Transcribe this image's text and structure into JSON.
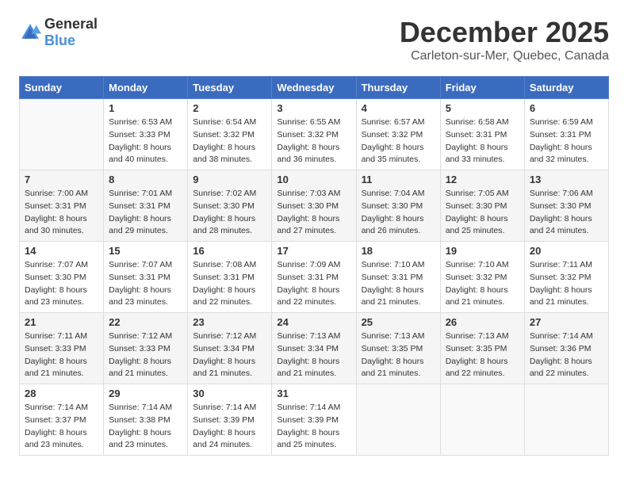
{
  "logo": {
    "text_general": "General",
    "text_blue": "Blue"
  },
  "title": {
    "month": "December 2025",
    "location": "Carleton-sur-Mer, Quebec, Canada"
  },
  "weekdays": [
    "Sunday",
    "Monday",
    "Tuesday",
    "Wednesday",
    "Thursday",
    "Friday",
    "Saturday"
  ],
  "weeks": [
    [
      {
        "day": "",
        "sunrise": "",
        "sunset": "",
        "daylight": ""
      },
      {
        "day": "1",
        "sunrise": "Sunrise: 6:53 AM",
        "sunset": "Sunset: 3:33 PM",
        "daylight": "Daylight: 8 hours and 40 minutes."
      },
      {
        "day": "2",
        "sunrise": "Sunrise: 6:54 AM",
        "sunset": "Sunset: 3:32 PM",
        "daylight": "Daylight: 8 hours and 38 minutes."
      },
      {
        "day": "3",
        "sunrise": "Sunrise: 6:55 AM",
        "sunset": "Sunset: 3:32 PM",
        "daylight": "Daylight: 8 hours and 36 minutes."
      },
      {
        "day": "4",
        "sunrise": "Sunrise: 6:57 AM",
        "sunset": "Sunset: 3:32 PM",
        "daylight": "Daylight: 8 hours and 35 minutes."
      },
      {
        "day": "5",
        "sunrise": "Sunrise: 6:58 AM",
        "sunset": "Sunset: 3:31 PM",
        "daylight": "Daylight: 8 hours and 33 minutes."
      },
      {
        "day": "6",
        "sunrise": "Sunrise: 6:59 AM",
        "sunset": "Sunset: 3:31 PM",
        "daylight": "Daylight: 8 hours and 32 minutes."
      }
    ],
    [
      {
        "day": "7",
        "sunrise": "Sunrise: 7:00 AM",
        "sunset": "Sunset: 3:31 PM",
        "daylight": "Daylight: 8 hours and 30 minutes."
      },
      {
        "day": "8",
        "sunrise": "Sunrise: 7:01 AM",
        "sunset": "Sunset: 3:31 PM",
        "daylight": "Daylight: 8 hours and 29 minutes."
      },
      {
        "day": "9",
        "sunrise": "Sunrise: 7:02 AM",
        "sunset": "Sunset: 3:30 PM",
        "daylight": "Daylight: 8 hours and 28 minutes."
      },
      {
        "day": "10",
        "sunrise": "Sunrise: 7:03 AM",
        "sunset": "Sunset: 3:30 PM",
        "daylight": "Daylight: 8 hours and 27 minutes."
      },
      {
        "day": "11",
        "sunrise": "Sunrise: 7:04 AM",
        "sunset": "Sunset: 3:30 PM",
        "daylight": "Daylight: 8 hours and 26 minutes."
      },
      {
        "day": "12",
        "sunrise": "Sunrise: 7:05 AM",
        "sunset": "Sunset: 3:30 PM",
        "daylight": "Daylight: 8 hours and 25 minutes."
      },
      {
        "day": "13",
        "sunrise": "Sunrise: 7:06 AM",
        "sunset": "Sunset: 3:30 PM",
        "daylight": "Daylight: 8 hours and 24 minutes."
      }
    ],
    [
      {
        "day": "14",
        "sunrise": "Sunrise: 7:07 AM",
        "sunset": "Sunset: 3:30 PM",
        "daylight": "Daylight: 8 hours and 23 minutes."
      },
      {
        "day": "15",
        "sunrise": "Sunrise: 7:07 AM",
        "sunset": "Sunset: 3:31 PM",
        "daylight": "Daylight: 8 hours and 23 minutes."
      },
      {
        "day": "16",
        "sunrise": "Sunrise: 7:08 AM",
        "sunset": "Sunset: 3:31 PM",
        "daylight": "Daylight: 8 hours and 22 minutes."
      },
      {
        "day": "17",
        "sunrise": "Sunrise: 7:09 AM",
        "sunset": "Sunset: 3:31 PM",
        "daylight": "Daylight: 8 hours and 22 minutes."
      },
      {
        "day": "18",
        "sunrise": "Sunrise: 7:10 AM",
        "sunset": "Sunset: 3:31 PM",
        "daylight": "Daylight: 8 hours and 21 minutes."
      },
      {
        "day": "19",
        "sunrise": "Sunrise: 7:10 AM",
        "sunset": "Sunset: 3:32 PM",
        "daylight": "Daylight: 8 hours and 21 minutes."
      },
      {
        "day": "20",
        "sunrise": "Sunrise: 7:11 AM",
        "sunset": "Sunset: 3:32 PM",
        "daylight": "Daylight: 8 hours and 21 minutes."
      }
    ],
    [
      {
        "day": "21",
        "sunrise": "Sunrise: 7:11 AM",
        "sunset": "Sunset: 3:33 PM",
        "daylight": "Daylight: 8 hours and 21 minutes."
      },
      {
        "day": "22",
        "sunrise": "Sunrise: 7:12 AM",
        "sunset": "Sunset: 3:33 PM",
        "daylight": "Daylight: 8 hours and 21 minutes."
      },
      {
        "day": "23",
        "sunrise": "Sunrise: 7:12 AM",
        "sunset": "Sunset: 3:34 PM",
        "daylight": "Daylight: 8 hours and 21 minutes."
      },
      {
        "day": "24",
        "sunrise": "Sunrise: 7:13 AM",
        "sunset": "Sunset: 3:34 PM",
        "daylight": "Daylight: 8 hours and 21 minutes."
      },
      {
        "day": "25",
        "sunrise": "Sunrise: 7:13 AM",
        "sunset": "Sunset: 3:35 PM",
        "daylight": "Daylight: 8 hours and 21 minutes."
      },
      {
        "day": "26",
        "sunrise": "Sunrise: 7:13 AM",
        "sunset": "Sunset: 3:35 PM",
        "daylight": "Daylight: 8 hours and 22 minutes."
      },
      {
        "day": "27",
        "sunrise": "Sunrise: 7:14 AM",
        "sunset": "Sunset: 3:36 PM",
        "daylight": "Daylight: 8 hours and 22 minutes."
      }
    ],
    [
      {
        "day": "28",
        "sunrise": "Sunrise: 7:14 AM",
        "sunset": "Sunset: 3:37 PM",
        "daylight": "Daylight: 8 hours and 23 minutes."
      },
      {
        "day": "29",
        "sunrise": "Sunrise: 7:14 AM",
        "sunset": "Sunset: 3:38 PM",
        "daylight": "Daylight: 8 hours and 23 minutes."
      },
      {
        "day": "30",
        "sunrise": "Sunrise: 7:14 AM",
        "sunset": "Sunset: 3:39 PM",
        "daylight": "Daylight: 8 hours and 24 minutes."
      },
      {
        "day": "31",
        "sunrise": "Sunrise: 7:14 AM",
        "sunset": "Sunset: 3:39 PM",
        "daylight": "Daylight: 8 hours and 25 minutes."
      },
      {
        "day": "",
        "sunrise": "",
        "sunset": "",
        "daylight": ""
      },
      {
        "day": "",
        "sunrise": "",
        "sunset": "",
        "daylight": ""
      },
      {
        "day": "",
        "sunrise": "",
        "sunset": "",
        "daylight": ""
      }
    ]
  ]
}
